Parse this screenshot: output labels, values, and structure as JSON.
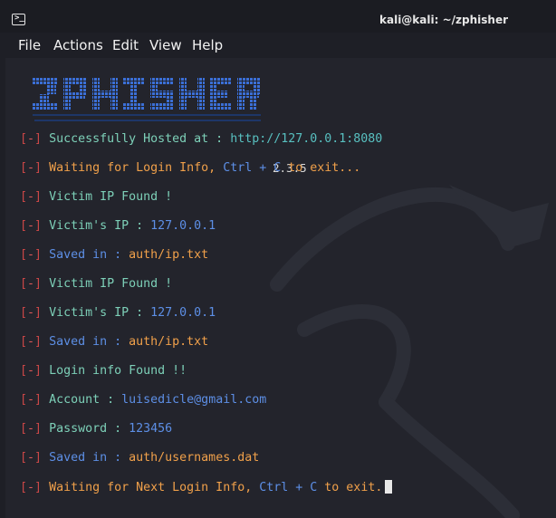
{
  "window": {
    "title": "kali@kali: ~/zphisher",
    "icon": "terminal-icon"
  },
  "menu": [
    "File",
    "Actions",
    "Edit",
    "View",
    "Help"
  ],
  "banner": {
    "logo": "ZPHISHER",
    "version": "2.3.5"
  },
  "prefix": {
    "open": "[",
    "mark": "-",
    "close": "]"
  },
  "lines": {
    "hosted": {
      "label": "Successfully Hosted at : ",
      "url": "http://127.0.0.1:8080"
    },
    "waiting1": {
      "a": "Waiting for Login Info, ",
      "b": "Ctrl + C",
      "c": " to exit..."
    },
    "victim_found1": "Victim IP Found !",
    "victim_ip1": {
      "label": "Victim's IP : ",
      "value": "127.0.0.1"
    },
    "saved1": {
      "label": "Saved in : ",
      "value": "auth/ip.txt"
    },
    "victim_found2": "Victim IP Found !",
    "victim_ip2": {
      "label": "Victim's IP : ",
      "value": "127.0.0.1"
    },
    "saved2": {
      "label": "Saved in : ",
      "value": "auth/ip.txt"
    },
    "login_found": "Login info Found !!",
    "account": {
      "label": "Account : ",
      "value": "luisedicle@gmail.com"
    },
    "password": {
      "label": "Password : ",
      "value": "123456"
    },
    "saved3": {
      "label": "Saved in : ",
      "value": "auth/usernames.dat"
    },
    "waiting2": {
      "a": "Waiting for Next Login Info, ",
      "b": "Ctrl + C",
      "c": " to exit."
    }
  },
  "colors": {
    "bracket": "#c94747",
    "green": "#7dd0b8",
    "orange": "#f0a04a",
    "blue": "#5d8fe6"
  }
}
